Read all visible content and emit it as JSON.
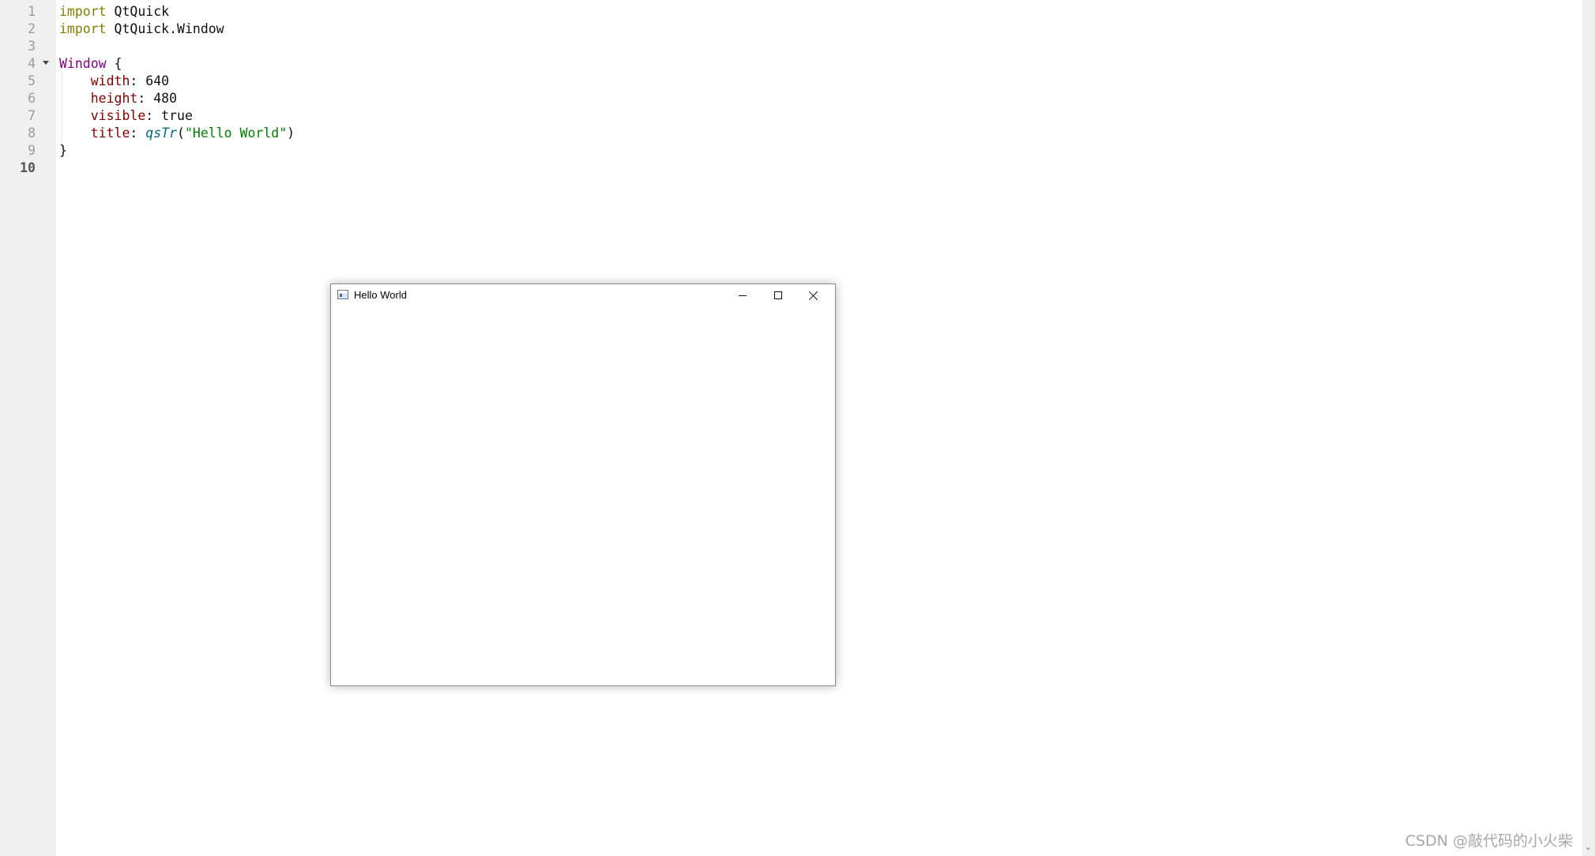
{
  "editor": {
    "line_numbers": [
      "1",
      "2",
      "3",
      "4",
      "5",
      "6",
      "7",
      "8",
      "9",
      "10"
    ],
    "current_line": "10",
    "lines": {
      "l1": {
        "keyword": "import",
        "module": "QtQuick"
      },
      "l2": {
        "keyword": "import",
        "module": "QtQuick.Window"
      },
      "l4": {
        "type": "Window",
        "brace_open": "{"
      },
      "l5": {
        "prop": "width",
        "value": "640"
      },
      "l6": {
        "prop": "height",
        "value": "480"
      },
      "l7": {
        "prop": "visible",
        "value": "true"
      },
      "l8": {
        "prop": "title",
        "func": "qsTr",
        "string": "\"Hello World\""
      },
      "l9": {
        "brace_close": "}"
      }
    },
    "fold_icon": "fold-arrow-down-icon"
  },
  "qml_window": {
    "title": "Hello World",
    "icons": {
      "app": "app-window-icon",
      "minimize": "minimize-icon",
      "maximize": "maximize-icon",
      "close": "close-icon"
    }
  },
  "scrollbar": {
    "down_arrow": "⌄"
  },
  "watermark": "CSDN @敲代码的小火柴",
  "colors": {
    "import_keyword": "#808000",
    "type_keyword": "#800080",
    "property": "#800000",
    "function": "#00677c",
    "string": "#008000",
    "gutter_bg": "#f0f0f0"
  }
}
